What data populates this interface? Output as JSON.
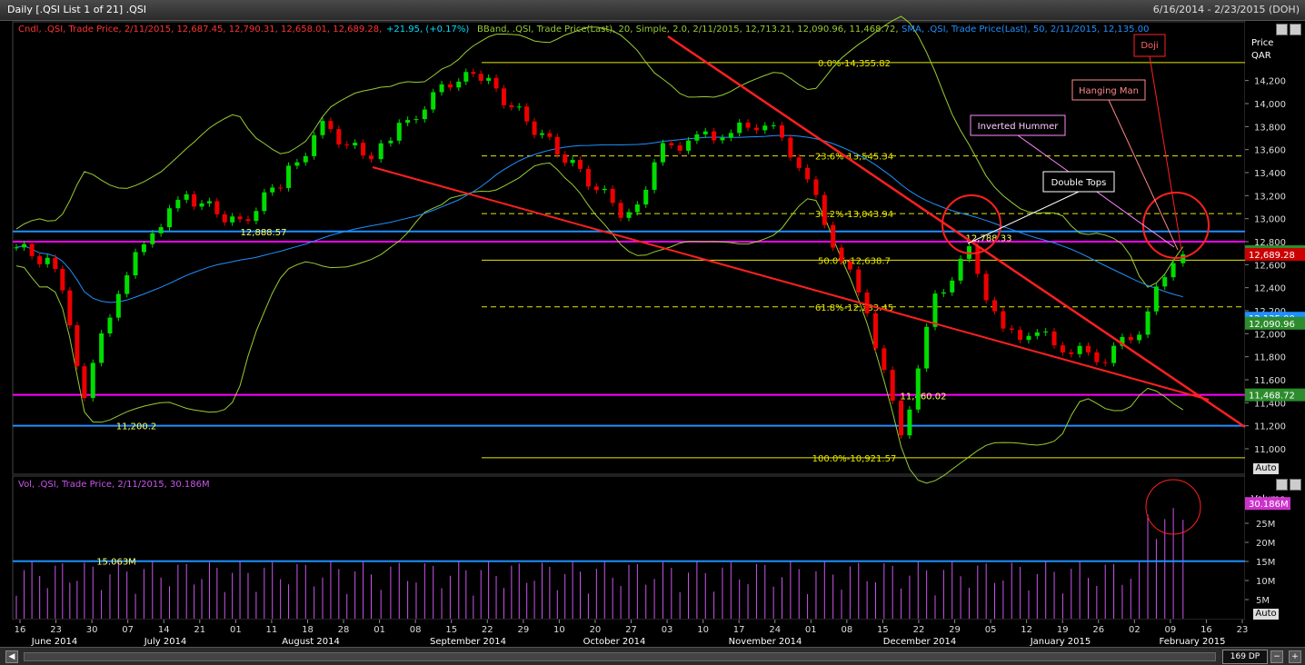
{
  "window": {
    "title": "Daily [.QSI List 1 of 21] .QSI",
    "date_range": "6/16/2014 - 2/23/2015 (DOH)"
  },
  "legend": {
    "cndl": "Cndl, .QSI, Trade Price, 2/11/2015, 12,687.45, 12,790.31, 12,658.01, 12,689.28,",
    "cndl_change": "+21.95, (+0.17%)",
    "bband": "BBand, .QSI, Trade Price(Last),  20, Simple, 2.0, 2/11/2015, 12,713.21, 12,090.96, 11,468.72,",
    "sma": "SMA, .QSI, Trade Price(Last),  50,  2/11/2015, 12,135.00",
    "vol": "Vol, .QSI, Trade Price, 2/11/2015, 30.186M"
  },
  "price_axis": {
    "title": "Price",
    "unit": "QAR",
    "ticks": [
      "14,200",
      "14,000",
      "13,800",
      "13,600",
      "13,400",
      "13,200",
      "13,000",
      "12,800",
      "12,600",
      "12,400",
      "12,200",
      "12,000",
      "11,800",
      "11,600",
      "11,400",
      "11,200",
      "11,000"
    ],
    "auto": "Auto"
  },
  "volume_axis": {
    "title": "Volume",
    "ticks": [
      "25M",
      "20M",
      "15M",
      "10M",
      "5M"
    ],
    "auto": "Auto"
  },
  "price_badges": [
    {
      "text": "12,713.21",
      "bg": "#2d8c2d",
      "fg": "#ffffff",
      "value": 12713.21
    },
    {
      "text": "12,689.28",
      "bg": "#cc0000",
      "fg": "#ffffff",
      "value": 12689.28
    },
    {
      "text": "12,135.00",
      "bg": "#1e90ff",
      "fg": "#ffffff",
      "value": 12135.0
    },
    {
      "text": "12,090.96",
      "bg": "#2d8c2d",
      "fg": "#ffffff",
      "value": 12090.96
    },
    {
      "text": "11,468.72",
      "bg": "#2d8c2d",
      "fg": "#ffffff",
      "value": 11468.72
    }
  ],
  "volume_badge": {
    "text": "30.186M",
    "bg": "#cc33cc",
    "value": 30.186
  },
  "fibonacci": [
    {
      "label": "0.0%-14,355.82",
      "value": 14355.82,
      "style": "solid"
    },
    {
      "label": "23.6%-13,545.34",
      "value": 13545.34,
      "style": "dashed"
    },
    {
      "label": "38.2%-13,043.94",
      "value": 13043.94,
      "style": "dashed"
    },
    {
      "label": "50.0%-12,638.7",
      "value": 12638.7,
      "style": "solid"
    },
    {
      "label": "61.8%-12,233.45",
      "value": 12233.45,
      "style": "dashed"
    },
    {
      "label": "100.0%-10,921.57",
      "value": 10921.57,
      "style": "solid"
    }
  ],
  "horizontal_lines": [
    {
      "value": 12888.57,
      "color": "#1e90ff"
    },
    {
      "value": 12800,
      "color": "#ff00ff"
    },
    {
      "value": 11468.72,
      "color": "#ff00ff"
    },
    {
      "value": 11200.2,
      "color": "#1e90ff"
    }
  ],
  "price_labels": [
    {
      "text": "12,888.57",
      "value": 12888.57
    },
    {
      "text": "12,788.33",
      "value": 12788.33
    },
    {
      "text": "11,460.02",
      "value": 11460.02
    },
    {
      "text": "11,200.2",
      "value": 11200.2
    }
  ],
  "volume_level": {
    "text": "15.063M",
    "value": 15.063
  },
  "annotations": [
    {
      "text": "Doji",
      "kind": "red-box"
    },
    {
      "text": "Hanging Man",
      "kind": "pink-box"
    },
    {
      "text": "Inverted Hummer",
      "kind": "pink-box"
    },
    {
      "text": "Double Tops",
      "kind": "white-box"
    }
  ],
  "time_axis": {
    "day_ticks": [
      "16",
      "23",
      "30",
      "07",
      "14",
      "21",
      "01",
      "11",
      "18",
      "28",
      "01",
      "08",
      "15",
      "22",
      "29",
      "10",
      "20",
      "27",
      "03",
      "10",
      "17",
      "24",
      "01",
      "08",
      "15",
      "22",
      "29",
      "05",
      "12",
      "19",
      "26",
      "02",
      "09",
      "16",
      "23"
    ],
    "months": [
      "June 2014",
      "July 2014",
      "August 2014",
      "September 2014",
      "October 2014",
      "November 2014",
      "December 2014",
      "January 2015",
      "February 2015"
    ]
  },
  "bottom_bar": {
    "dp": "169 DP"
  },
  "colors": {
    "up": "#00dd00",
    "down": "#ee0000",
    "bband": "#99cc33",
    "sma": "#1e90ff",
    "trend": "#ff2020",
    "fib": "#e8e800",
    "volume": "#cc55ee",
    "grid": "#2a2a2a"
  },
  "chart_data": [
    {
      "type": "candlestick",
      "title": "Daily [.QSI List 1 of 21] .QSI",
      "ylabel": "Price QAR",
      "ylim": [
        10900,
        14500
      ],
      "x_range": [
        "2014-06-16",
        "2015-02-23"
      ],
      "last_bar": {
        "date": "2015-02-11",
        "open": 12687.45,
        "high": 12790.31,
        "low": 12658.01,
        "close": 12689.28,
        "change": 21.95,
        "change_pct": 0.17
      },
      "close_approx": [
        {
          "date": "2014-06-16",
          "value": 12750
        },
        {
          "date": "2014-06-24",
          "value": 12600
        },
        {
          "date": "2014-06-30",
          "value": 11500
        },
        {
          "date": "2014-07-07",
          "value": 12400
        },
        {
          "date": "2014-07-14",
          "value": 12900
        },
        {
          "date": "2014-07-21",
          "value": 13200
        },
        {
          "date": "2014-08-01",
          "value": 12950
        },
        {
          "date": "2014-08-11",
          "value": 13400
        },
        {
          "date": "2014-08-18",
          "value": 13800
        },
        {
          "date": "2014-08-28",
          "value": 13500
        },
        {
          "date": "2014-09-01",
          "value": 13700
        },
        {
          "date": "2014-09-08",
          "value": 14000
        },
        {
          "date": "2014-09-15",
          "value": 14250
        },
        {
          "date": "2014-09-18",
          "value": 14300
        },
        {
          "date": "2014-09-29",
          "value": 13850
        },
        {
          "date": "2014-10-10",
          "value": 13400
        },
        {
          "date": "2014-10-20",
          "value": 13000
        },
        {
          "date": "2014-10-27",
          "value": 13600
        },
        {
          "date": "2014-11-03",
          "value": 13700
        },
        {
          "date": "2014-11-10",
          "value": 13750
        },
        {
          "date": "2014-11-17",
          "value": 13850
        },
        {
          "date": "2014-11-24",
          "value": 13500
        },
        {
          "date": "2014-12-01",
          "value": 12800
        },
        {
          "date": "2014-12-08",
          "value": 12200
        },
        {
          "date": "2014-12-15",
          "value": 11100
        },
        {
          "date": "2014-12-22",
          "value": 12300
        },
        {
          "date": "2014-12-29",
          "value": 12700
        },
        {
          "date": "2015-01-05",
          "value": 12000
        },
        {
          "date": "2015-01-12",
          "value": 12000
        },
        {
          "date": "2015-01-19",
          "value": 11850
        },
        {
          "date": "2015-01-26",
          "value": 11800
        },
        {
          "date": "2015-02-02",
          "value": 12050
        },
        {
          "date": "2015-02-09",
          "value": 12650
        },
        {
          "date": "2015-02-11",
          "value": 12689.28
        }
      ],
      "bollinger": {
        "period": 20,
        "std": 2.0,
        "upper": 12713.21,
        "middle": 12090.96,
        "lower": 11468.72
      },
      "sma": {
        "period": 50,
        "value": 12135.0
      }
    },
    {
      "type": "bar",
      "title": "Vol, .QSI, Trade Price",
      "ylabel": "Volume",
      "ylim": [
        0,
        33
      ],
      "unit": "M",
      "last_value": 30.186,
      "reference_level": 15.063
    }
  ]
}
